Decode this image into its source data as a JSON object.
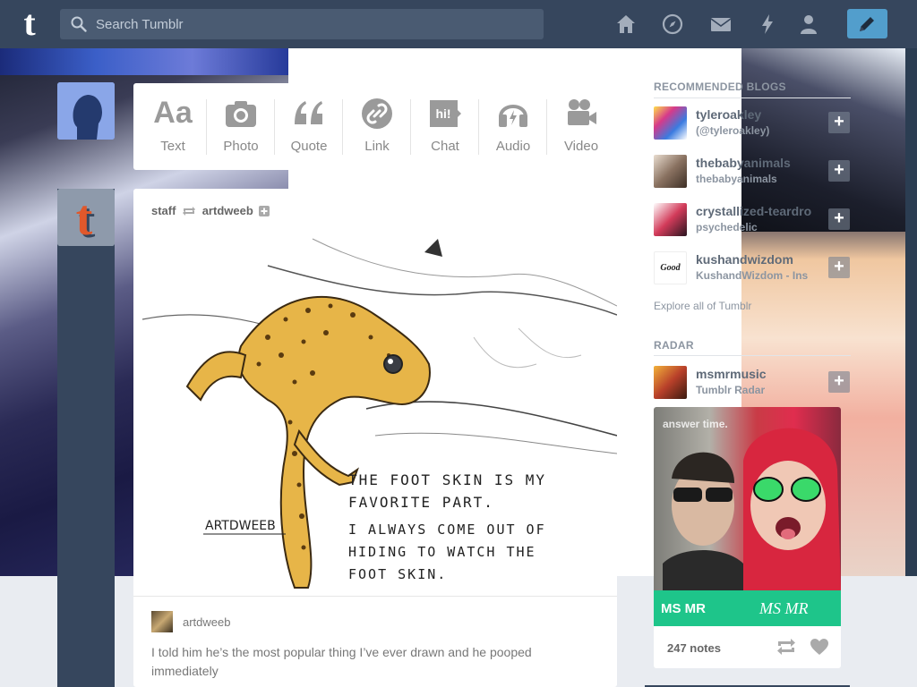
{
  "header": {
    "logo": "t",
    "search_placeholder": "Search Tumblr",
    "nav_icons": [
      "home-icon",
      "explore-compass-icon",
      "inbox-envelope-icon",
      "activity-lightning-icon",
      "account-person-icon"
    ],
    "compose_icon": "pencil-icon"
  },
  "post_types": [
    {
      "label": "Text",
      "icon": "text-aa-icon",
      "glyph": "Aa"
    },
    {
      "label": "Photo",
      "icon": "camera-icon",
      "glyph": ""
    },
    {
      "label": "Quote",
      "icon": "quote-icon",
      "glyph": "“"
    },
    {
      "label": "Link",
      "icon": "link-icon",
      "glyph": ""
    },
    {
      "label": "Chat",
      "icon": "chat-icon",
      "glyph": "hi!"
    },
    {
      "label": "Audio",
      "icon": "headphones-icon",
      "glyph": ""
    },
    {
      "label": "Video",
      "icon": "video-camera-icon",
      "glyph": ""
    }
  ],
  "post": {
    "reblogged_by": "staff",
    "original_author": "artdweeb",
    "drawing_text": [
      "THE FOOT SKIN IS MY",
      "FAVORITE PART.",
      "I ALWAYS COME OUT OF",
      "HIDING TO WATCH THE",
      "FOOT SKIN."
    ],
    "signature": "ARTDWEEB",
    "caption_author": "artdweeb",
    "caption": "I told him he’s the most popular thing I’ve ever drawn and he pooped immediately"
  },
  "sidebar": {
    "recommended_title": "RECOMMENDED BLOGS",
    "blogs": [
      {
        "name": "tyleroakley",
        "sub": "(@tyleroakley)",
        "color": "#c23a8f"
      },
      {
        "name": "thebabyanimals",
        "sub": "thebabyanimals",
        "color": "#8a7261"
      },
      {
        "name": "crystallized-teardro",
        "sub": "psychedelic",
        "color": "#d23b5a"
      },
      {
        "name": "kushandwizdom",
        "sub": "KushandWizdom - Ins",
        "color": "#222222"
      }
    ],
    "plus_label": "+",
    "explore_link": "Explore all of Tumblr",
    "radar_title": "RADAR",
    "radar_blog": {
      "name": "msmrmusic",
      "sub": "Tumblr Radar",
      "color": "#c7842f"
    },
    "radar_watermark": "answer time.",
    "radar_banner_text": "MS MR",
    "radar_banner_signature": "MS MR",
    "notes": "247 notes"
  }
}
